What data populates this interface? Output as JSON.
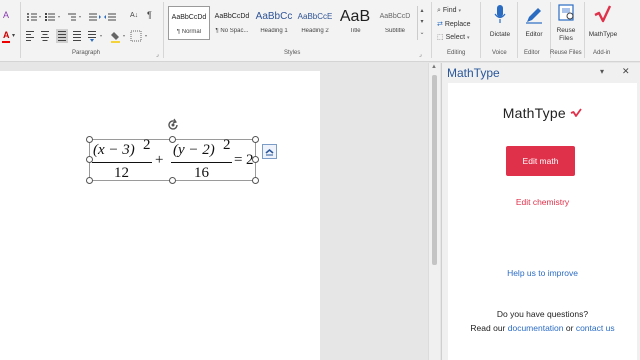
{
  "ribbon": {
    "paragraph_label": "Paragraph",
    "styles_label": "Styles",
    "editing_label": "Editing",
    "voice_label": "Voice",
    "editor_label": "Editor",
    "reuse_files_label": "Reuse Files",
    "addin_label": "Add-in",
    "styles": [
      {
        "sample": "AaBbCcDd",
        "name": "¶ Normal",
        "selected": true
      },
      {
        "sample": "AaBbCcDd",
        "name": "¶ No Spac..."
      },
      {
        "sample": "AaBbCc",
        "name": "Heading 1"
      },
      {
        "sample": "AaBbCcE",
        "name": "Heading 2"
      },
      {
        "sample": "AaB",
        "name": "Title"
      },
      {
        "sample": "AaBbCcD",
        "name": "Subtitle"
      }
    ],
    "find_label": "Find",
    "replace_label": "Replace",
    "select_label": "Select",
    "dictate_label": "Dictate",
    "editor_button_label": "Editor",
    "reuse_files_button_label": "Reuse Files",
    "mathtype_button_label": "MathType",
    "sort_glyph": "A↓",
    "pilcrow_glyph": "¶"
  },
  "equation": {
    "num1": "(x − 3)",
    "exp1": "2",
    "den1": "12",
    "plus": "+",
    "num2": "(y − 2)",
    "exp2": "2",
    "den2": "16",
    "equals": "=",
    "rhs": "2"
  },
  "pane": {
    "title": "MathType",
    "close_glyph": "✕",
    "dropdown_glyph": "▾",
    "logo_text": "MathType",
    "edit_math_label": "Edit math",
    "edit_chemistry_label": "Edit chemistry",
    "help_label": "Help us to improve",
    "questions_text": "Do you have questions?",
    "read_our": "Read our",
    "documentation_link": "documentation",
    "or_text": "or",
    "contact_link": "contact us"
  },
  "colors": {
    "accent": "#2a579a",
    "mathtype_red": "#e0314b",
    "link_blue": "#2b6cc4"
  }
}
